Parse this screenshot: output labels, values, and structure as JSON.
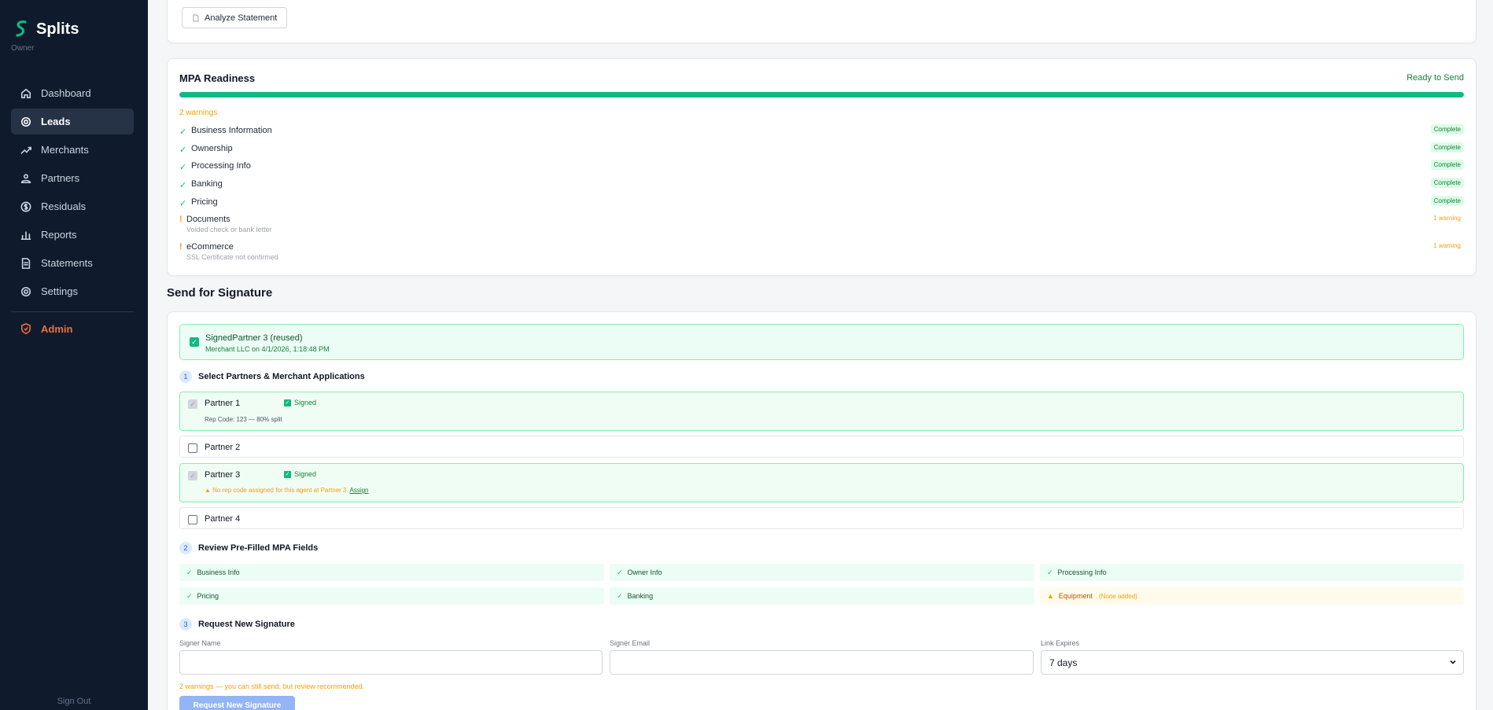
{
  "sidebar": {
    "brand": "Splits",
    "role": "Owner",
    "items": [
      {
        "label": "Dashboard",
        "icon": "home-icon"
      },
      {
        "label": "Leads",
        "icon": "target-icon"
      },
      {
        "label": "Merchants",
        "icon": "trend-icon"
      },
      {
        "label": "Partners",
        "icon": "partners-icon"
      },
      {
        "label": "Residuals",
        "icon": "dollar-icon"
      },
      {
        "label": "Reports",
        "icon": "bar-chart-icon"
      },
      {
        "label": "Statements",
        "icon": "document-icon"
      },
      {
        "label": "Settings",
        "icon": "gear-icon"
      }
    ],
    "active": "Leads",
    "admin": "Admin",
    "sign_out": "Sign Out"
  },
  "analyze": {
    "label": "Analyze Statement"
  },
  "mpa": {
    "title": "MPA Readiness",
    "status": "Ready to Send",
    "progress": 100,
    "warnings": "2 warnings",
    "items": [
      {
        "label": "Business Information",
        "badge": "Complete"
      },
      {
        "label": "Ownership",
        "badge": "Complete"
      },
      {
        "label": "Processing Info",
        "badge": "Complete"
      },
      {
        "label": "Banking",
        "badge": "Complete"
      },
      {
        "label": "Pricing",
        "badge": "Complete"
      },
      {
        "label": "Documents",
        "sub": "Voided check or bank letter",
        "badge": "1 warning"
      },
      {
        "label": "eCommerce",
        "sub": "SSL Certificate not confirmed",
        "badge": "1 warning"
      }
    ]
  },
  "signature": {
    "title": "Send for Signature",
    "signed_notice": {
      "line1": "SignedPartner 3 (reused)",
      "line2": "Merchant LLC on 4/1/2026, 1:18:48 PM"
    },
    "step1": {
      "num": "1",
      "title": "Select Partners & Merchant Applications"
    },
    "partners": [
      {
        "name": "Partner 1",
        "signed": "Signed",
        "sub": "Rep Code: 123 — 80% split"
      },
      {
        "name": "Partner 2"
      },
      {
        "name": "Partner 3",
        "signed": "Signed",
        "warn": "No rep code assigned for this agent at Partner 3.",
        "warn_link": "Assign"
      },
      {
        "name": "Partner 4"
      }
    ],
    "step2": {
      "num": "2",
      "title": "Review Pre-Filled MPA Fields"
    },
    "fields": [
      {
        "label": "Business Info"
      },
      {
        "label": "Owner Info"
      },
      {
        "label": "Processing Info"
      },
      {
        "label": "Pricing"
      },
      {
        "label": "Banking"
      },
      {
        "label": "Equipment",
        "note": "(None added)"
      }
    ],
    "step3": {
      "num": "3",
      "title": "Request New Signature"
    },
    "signer_name_label": "Signer Name",
    "signer_name_value": "",
    "signer_email_label": "Signer Email",
    "signer_email_value": "",
    "link_expires_label": "Link Expires",
    "link_expires_value": "7 days",
    "bottom_warning": "2 warnings — you can still send, but review recommended.",
    "request_button": "Request New Signature"
  },
  "colors": {
    "sidebar_bg": "#0f1b2d",
    "accent_green": "#10b981",
    "warning_orange": "#f59e0b",
    "admin_orange": "#f26d3d",
    "button_blue": "#93b4f5"
  }
}
